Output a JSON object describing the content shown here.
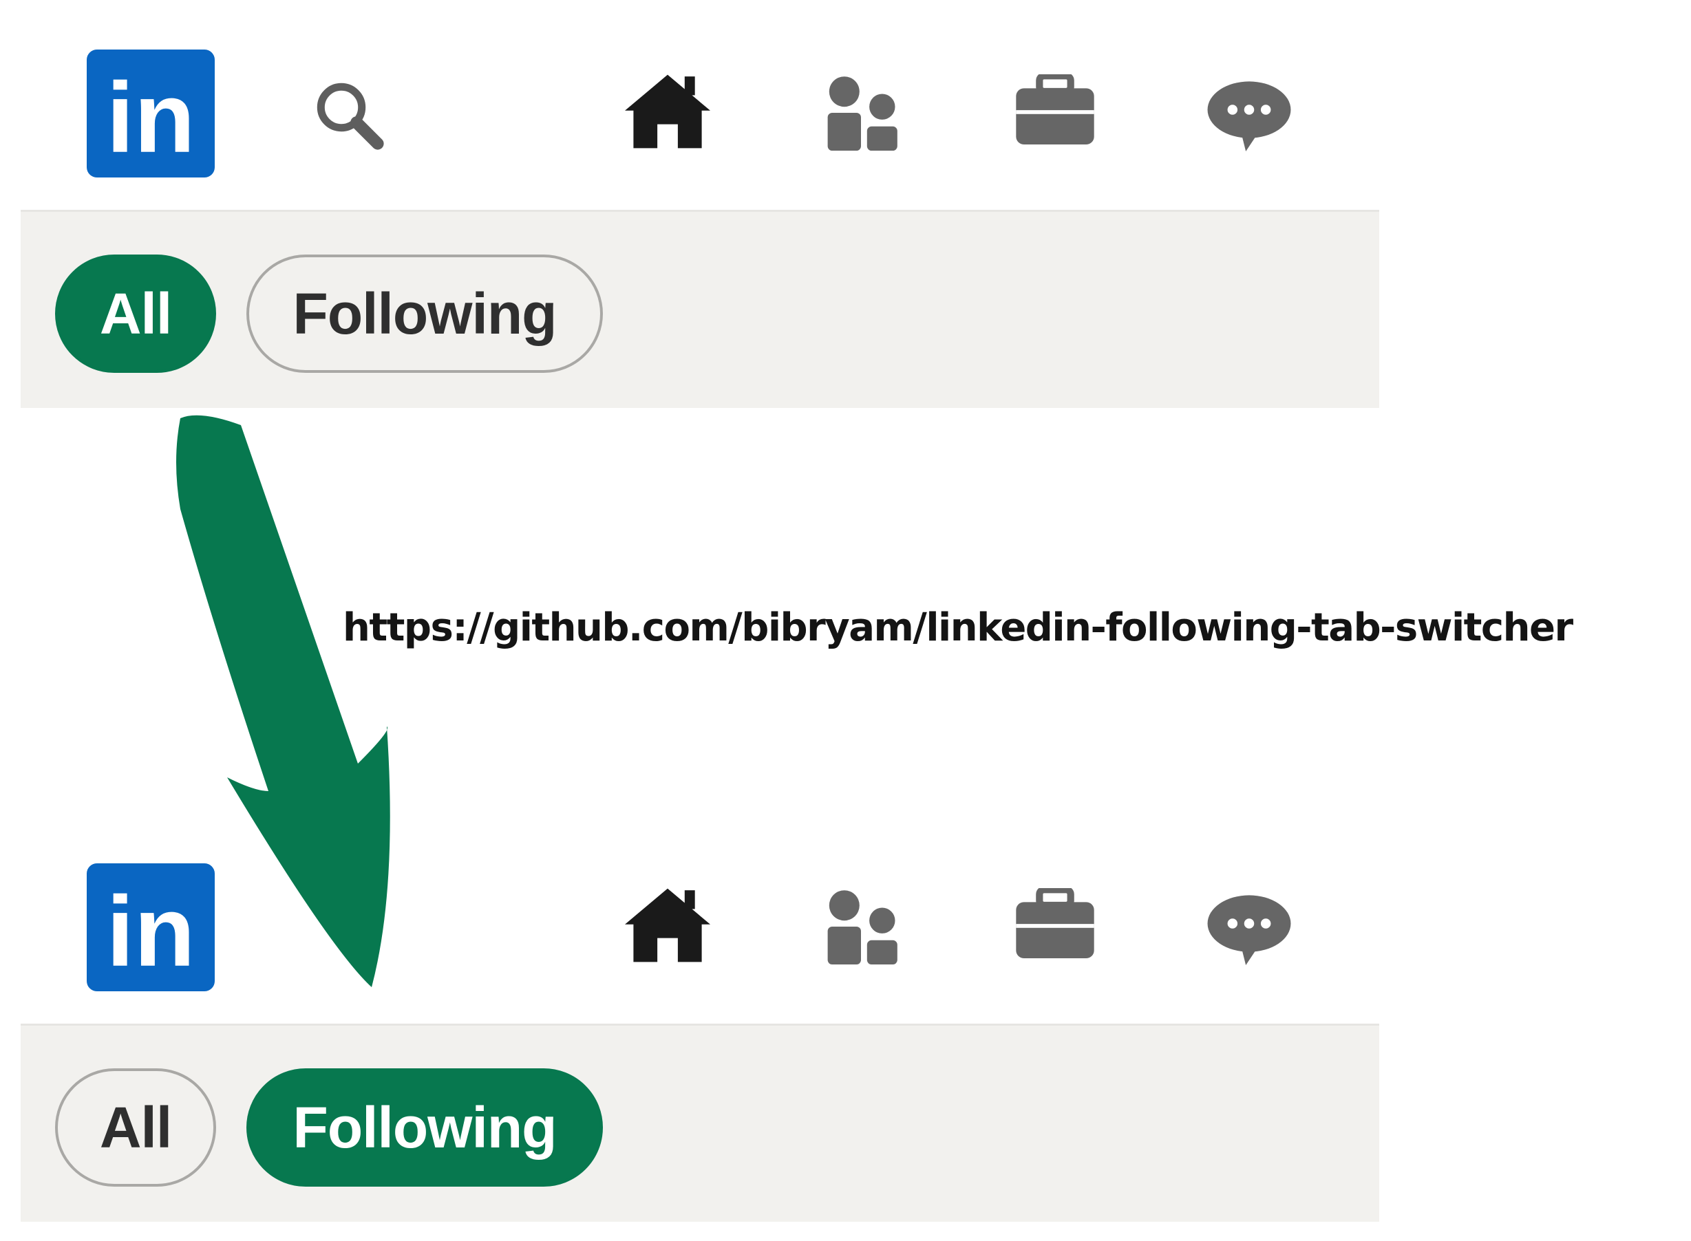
{
  "colors": {
    "brand_blue": "#0a66c2",
    "active_green": "#07784f",
    "arrow_green": "#07784f",
    "bar_background": "#f2f1ee",
    "icon_dark": "#1a1a1a",
    "icon_gray": "#666666"
  },
  "top": {
    "nav_icons": [
      "linkedin-logo",
      "search-icon",
      "home-icon",
      "my-network-icon",
      "jobs-icon",
      "messaging-icon"
    ],
    "logo_text": "in",
    "tabs": [
      {
        "label": "All",
        "active": true
      },
      {
        "label": "Following",
        "active": false
      }
    ]
  },
  "bottom": {
    "nav_icons": [
      "linkedin-logo",
      "home-icon",
      "my-network-icon",
      "jobs-icon",
      "messaging-icon"
    ],
    "logo_text": "in",
    "tabs": [
      {
        "label": "All",
        "active": false
      },
      {
        "label": "Following",
        "active": true
      }
    ]
  },
  "link": "https://github.com/bibryam/linkedin-following-tab-switcher"
}
